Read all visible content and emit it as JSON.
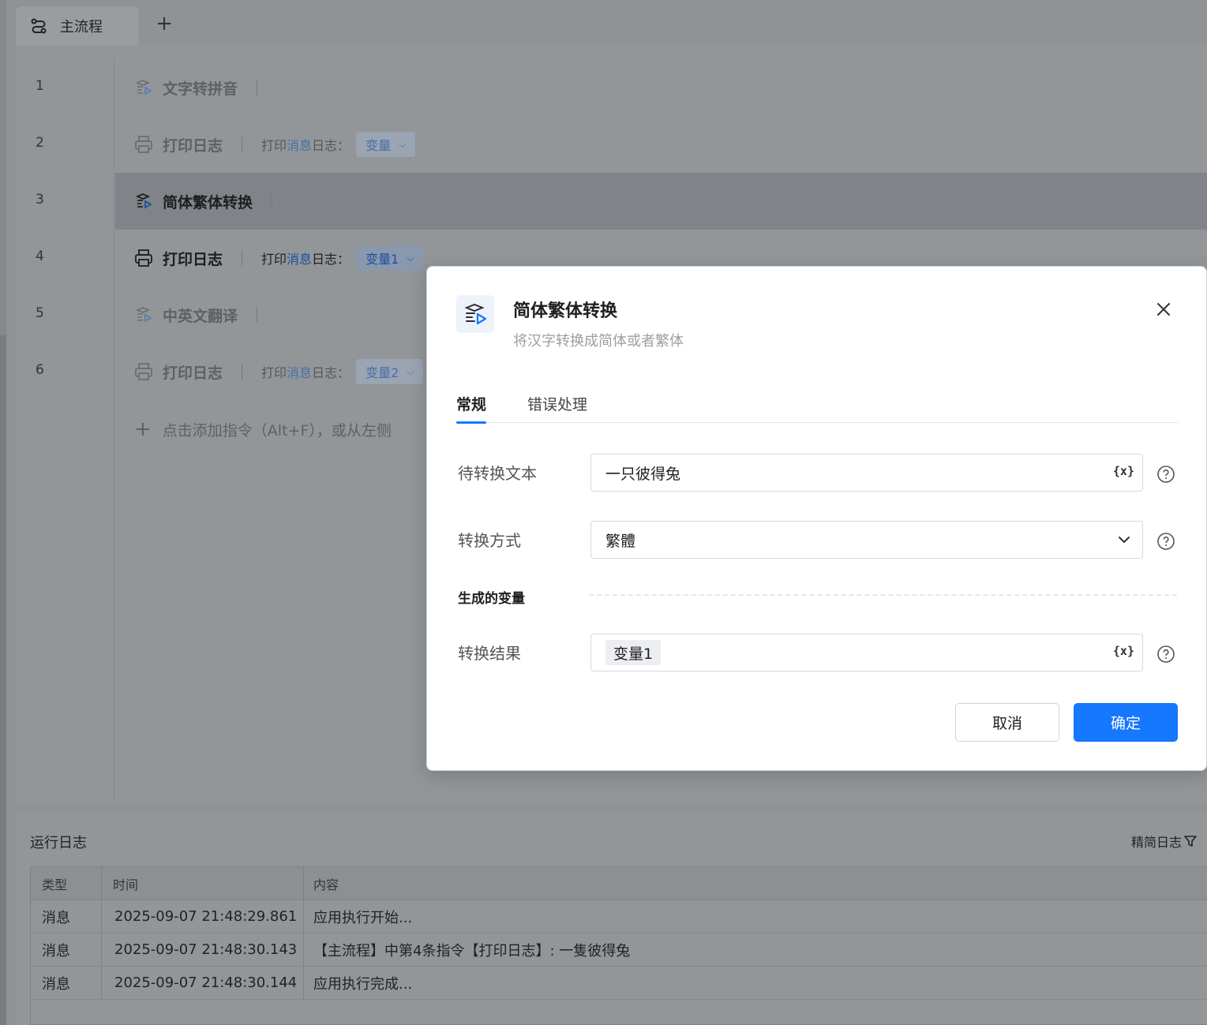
{
  "tabs": {
    "main_tab": "主流程",
    "add": "+"
  },
  "editor": {
    "rows": [
      {
        "num": "1",
        "name": "文字转拼音",
        "icon": "convert-icon"
      },
      {
        "num": "2",
        "name": "打印日志",
        "icon": "printer-icon",
        "param_pre": "打印",
        "param_hl": "消息",
        "param_post": "日志：",
        "chip": "变量"
      },
      {
        "num": "3",
        "name": "简体繁体转换",
        "icon": "convert-icon"
      },
      {
        "num": "4",
        "name": "打印日志",
        "icon": "printer-icon",
        "param_pre": "打印",
        "param_hl": "消息",
        "param_post": "日志：",
        "chip": "变量1"
      },
      {
        "num": "5",
        "name": "中英文翻译",
        "icon": "convert-icon"
      },
      {
        "num": "6",
        "name": "打印日志",
        "icon": "printer-icon",
        "param_pre": "打印",
        "param_hl": "消息",
        "param_post": "日志：",
        "chip": "变量2"
      }
    ],
    "add_hint": "点击添加指令（Alt+F），或从左侧"
  },
  "log": {
    "title": "运行日志",
    "filter": "精简日志",
    "headers": [
      "类型",
      "时间",
      "内容"
    ],
    "rows": [
      {
        "type": "消息",
        "time": "2025-09-07 21:48:29.861",
        "content": "应用执行开始..."
      },
      {
        "type": "消息",
        "time": "2025-09-07 21:48:30.143",
        "content": "【主流程】中第4条指令【打印日志】: 一隻彼得兔"
      },
      {
        "type": "消息",
        "time": "2025-09-07 21:48:30.144",
        "content": "应用执行完成..."
      }
    ]
  },
  "dialog": {
    "title": "简体繁体转换",
    "subtitle": "将汉字转换成简体或者繁体",
    "tabs": [
      "常规",
      "错误处理"
    ],
    "fields": {
      "text_label": "待转换文本",
      "text_value": "一只彼得兔",
      "mode_label": "转换方式",
      "mode_value": "繁體",
      "section": "生成的变量",
      "result_label": "转换结果",
      "result_value": "变量1"
    },
    "var_button": "{x}",
    "cancel": "取消",
    "ok": "确定"
  },
  "colors": {
    "primary": "#1677ff",
    "dialog_bg": "#ffffff",
    "overlay": "#8f9396"
  }
}
